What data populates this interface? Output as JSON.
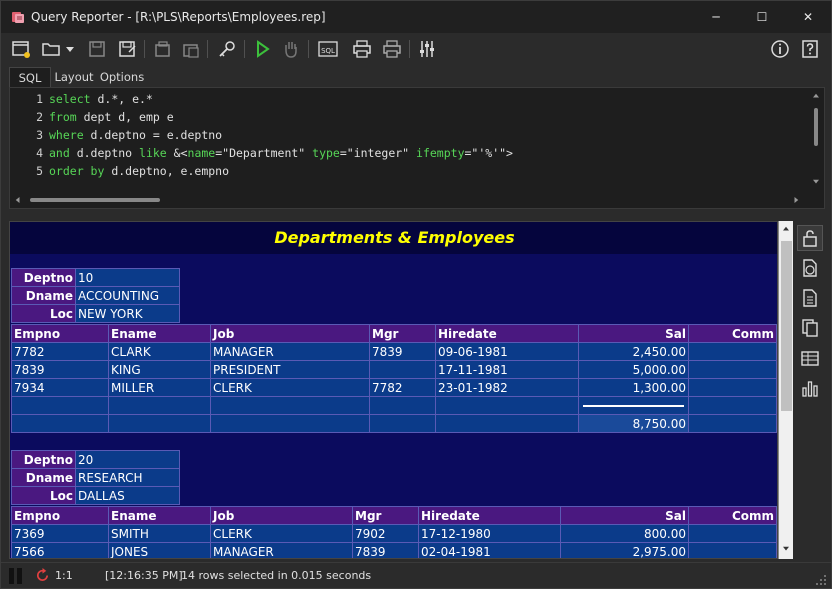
{
  "window": {
    "title": "Query Reporter - [R:\\PLS\\Reports\\Employees.rep]",
    "minimize_glyph": "─",
    "maximize_glyph": "☐",
    "close_glyph": "✕"
  },
  "toolbar": {
    "items": [
      "new-report-icon",
      "open-icon",
      "dropdown-arrow-icon",
      "save-icon",
      "save-as-icon",
      "copy-report-icon",
      "paste-report-icon",
      "connect-key-icon",
      "run-icon",
      "stop-hand-icon",
      "sql-icon",
      "print-icon",
      "print-preview-icon",
      "settings-sliders-icon",
      "info-icon",
      "help-icon"
    ],
    "sql_label": "SQL"
  },
  "tabs": [
    {
      "label": "SQL",
      "active": true
    },
    {
      "label": "Layout",
      "active": false
    },
    {
      "label": "Options",
      "active": false
    }
  ],
  "editor": {
    "line_numbers": [
      "1",
      "2",
      "3",
      "4",
      "5"
    ],
    "lines": [
      [
        {
          "t": "select",
          "kw": true
        },
        {
          "t": " d.*, e.*",
          "kw": false
        }
      ],
      [
        {
          "t": "from",
          "kw": true
        },
        {
          "t": " dept d, emp e",
          "kw": false
        }
      ],
      [
        {
          "t": "where",
          "kw": true
        },
        {
          "t": " d.deptno = e.deptno",
          "kw": false
        }
      ],
      [
        {
          "t": "and",
          "kw": true
        },
        {
          "t": " d.deptno ",
          "kw": false
        },
        {
          "t": "like",
          "kw": true
        },
        {
          "t": " &<",
          "kw": false
        },
        {
          "t": "name",
          "kw": true
        },
        {
          "t": "=\"Department\" ",
          "kw": false
        },
        {
          "t": "type",
          "kw": true
        },
        {
          "t": "=\"integer\" ",
          "kw": false
        },
        {
          "t": "ifempty",
          "kw": true
        },
        {
          "t": "=\"'%'\">",
          "kw": false
        }
      ],
      [
        {
          "t": "order by",
          "kw": true
        },
        {
          "t": " d.deptno, e.empno",
          "kw": false
        }
      ]
    ]
  },
  "report": {
    "title": "Departments & Employees",
    "master_labels": [
      "Deptno",
      "Dname",
      "Loc"
    ],
    "detail_headers": [
      "Empno",
      "Ename",
      "Job",
      "Mgr",
      "Hiredate",
      "Sal",
      "Comm"
    ],
    "groups": [
      {
        "deptno": "10",
        "dname": "ACCOUNTING",
        "loc": "NEW YORK",
        "rows": [
          [
            "7782",
            "CLARK",
            "MANAGER",
            "7839",
            "09-06-1981",
            "2,450.00",
            ""
          ],
          [
            "7839",
            "KING",
            "PRESIDENT",
            "",
            "17-11-1981",
            "5,000.00",
            ""
          ],
          [
            "7934",
            "MILLER",
            "CLERK",
            "7782",
            "23-01-1982",
            "1,300.00",
            ""
          ]
        ],
        "total": "8,750.00"
      },
      {
        "deptno": "20",
        "dname": "RESEARCH",
        "loc": "DALLAS",
        "rows": [
          [
            "7369",
            "SMITH",
            "CLERK",
            "7902",
            "17-12-1980",
            "800.00",
            ""
          ],
          [
            "7566",
            "JONES",
            "MANAGER",
            "7839",
            "02-04-1981",
            "2,975.00",
            ""
          ]
        ]
      }
    ]
  },
  "sidebar": {
    "items": [
      "unlock-icon",
      "export-html-icon",
      "export-text-icon",
      "copy-icon",
      "grid-table-icon",
      "bar-chart-icon"
    ]
  },
  "status": {
    "position": "1:1",
    "time": "[12:16:35 PM]",
    "message": "14 rows selected in 0.015 seconds"
  }
}
